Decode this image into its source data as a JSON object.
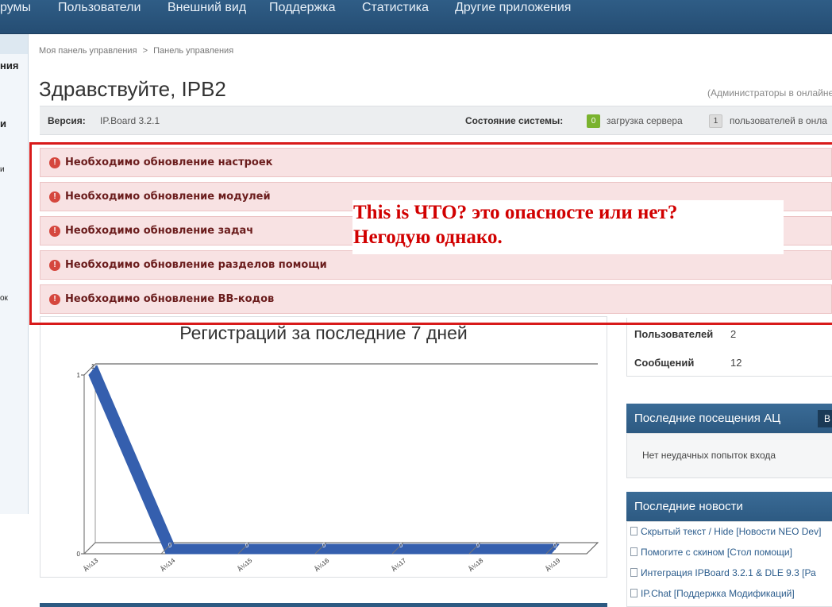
{
  "nav": {
    "items": [
      "румы",
      "Пользователи",
      "Внешний вид",
      "Поддержка",
      "Статистика",
      "Другие приложения"
    ]
  },
  "sidebar": {
    "fragments": [
      "ния",
      "и",
      "и",
      "ок"
    ]
  },
  "breadcrumb": {
    "home": "Моя панель управления",
    "separator": ">",
    "current": "Панель управления"
  },
  "page": {
    "title": "Здравствуйте, IPB2",
    "admins_online": "(Администраторы в онлайне"
  },
  "info": {
    "version_label": "Версия:",
    "version_value": "IP.Board 3.2.1",
    "status_label": "Состояние системы:",
    "server_load_value": "0",
    "server_load_label": "загрузка сервера",
    "users_online_value": "1",
    "users_online_label": "пользователей в онла"
  },
  "warnings": [
    "Необходимо обновление настроек",
    "Необходимо обновление модулей",
    "Необходимо обновление задач",
    "Необходимо обновление разделов помощи",
    "Необходимо обновление BB-кодов"
  ],
  "annotation": {
    "line1": "This is ЧТО? это опасносте или нет?",
    "line2": "Негодую однако."
  },
  "stats": {
    "users_label": "Пользователей",
    "users_value": "2",
    "posts_label": "Сообщений",
    "posts_value": "12"
  },
  "acp_visits": {
    "title": "Последние посещения АЦ",
    "button": "В",
    "empty_text": "Нет неудачных попыток входа"
  },
  "news": {
    "title": "Последние новости",
    "items": [
      "Скрытый текст / Hide [Новости NEO Dev]",
      "Помогите с скином [Стол помощи]",
      "Интеграция IPBoard 3.2.1 & DLE 9.3 [Ра",
      "IP.Chat [Поддержка Модификаций]"
    ]
  },
  "chart_data": {
    "type": "line",
    "title": "Регистраций за последние 7 дней",
    "categories": [
      "Â¼13",
      "Â¼14",
      "Â¼15",
      "Â¼16",
      "Â¼17",
      "Â¼18",
      "Â¼19"
    ],
    "values": [
      1,
      0,
      0,
      0,
      0,
      0,
      0
    ],
    "ylim": [
      0,
      1
    ],
    "y_ticks": [
      "0",
      "1"
    ],
    "series_color": "#355fae",
    "grid": false
  },
  "colors": {
    "nav_bg": "#2b5781",
    "warning_bg": "#f8e2e3",
    "warning_frame": "#d81a1a",
    "annotation_text": "#d10000"
  }
}
